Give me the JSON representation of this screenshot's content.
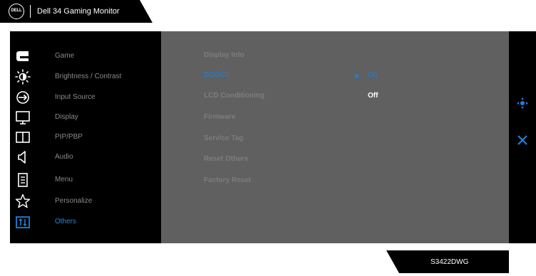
{
  "header": {
    "logo_text": "DELL",
    "title": "Dell 34 Gaming Monitor"
  },
  "sidebar": {
    "items": [
      {
        "label": "Game",
        "icon": "game-icon"
      },
      {
        "label": "Brightness / Contrast",
        "icon": "brightness-icon"
      },
      {
        "label": "Input Source",
        "icon": "input-source-icon"
      },
      {
        "label": "Display",
        "icon": "display-icon"
      },
      {
        "label": "PIP/PBP",
        "icon": "pip-pbp-icon"
      },
      {
        "label": "Audio",
        "icon": "audio-icon"
      },
      {
        "label": "Menu",
        "icon": "menu-icon"
      },
      {
        "label": "Personalize",
        "icon": "personalize-star-icon"
      },
      {
        "label": "Others",
        "icon": "others-icon"
      }
    ],
    "active_index": 8
  },
  "submenu": {
    "items": [
      {
        "label": "Display Info"
      },
      {
        "label": "DDC/CI"
      },
      {
        "label": "LCD Conditioning"
      },
      {
        "label": "Firmware"
      },
      {
        "label": "Service Tag"
      },
      {
        "label": "Reset Others"
      },
      {
        "label": "Factory Reset"
      }
    ],
    "active_index": 1
  },
  "options": {
    "items": [
      {
        "label": "On",
        "selected": true
      },
      {
        "label": "Off",
        "selected": false
      }
    ]
  },
  "navigation": {
    "icons": [
      "joystick-navigate-icon",
      "close-icon"
    ]
  },
  "footer": {
    "model": "S3422DWG"
  },
  "colors": {
    "accent": "#1f80d8",
    "panel_dark": "#000000",
    "panel_mid": "#606060",
    "inactive_text": "#8a8a8a"
  }
}
